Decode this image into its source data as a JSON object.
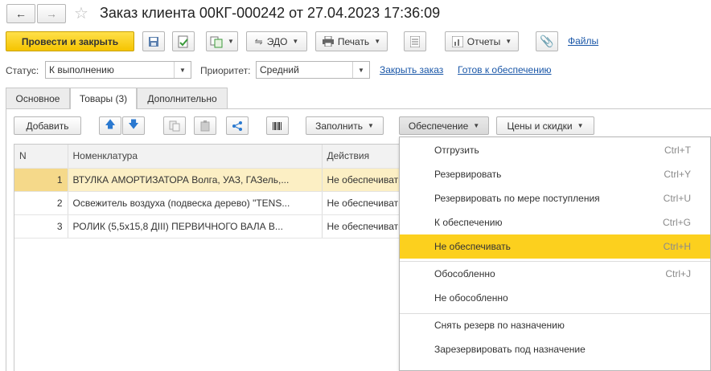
{
  "window": {
    "title": "Заказ клиента 00КГ-000242 от 27.04.2023 17:36:09"
  },
  "toolbar": {
    "post_close_label": "Провести и закрыть",
    "edo_label": "ЭДО",
    "print_label": "Печать",
    "reports_label": "Отчеты",
    "files_label": "Файлы"
  },
  "fields": {
    "status_label": "Статус:",
    "status_value": "К выполнению",
    "priority_label": "Приоритет:",
    "priority_value": "Средний",
    "close_order_link": "Закрыть заказ",
    "ready_link": "Готов к обеспечению"
  },
  "tabs": [
    {
      "label": "Основное"
    },
    {
      "label": "Товары (3)"
    },
    {
      "label": "Дополнительно"
    }
  ],
  "table_toolbar": {
    "add_label": "Добавить",
    "fill_label": "Заполнить",
    "provision_label": "Обеспечение",
    "prices_label": "Цены и скидки"
  },
  "table": {
    "headers": {
      "n": "N",
      "nomenclature": "Номенклатура",
      "actions": "Действия"
    },
    "rows": [
      {
        "n": "1",
        "nomenclature": "ВТУЛКА АМОРТИЗАТОРА Волга, УАЗ, ГАЗель,...",
        "action": "Не обеспечивать"
      },
      {
        "n": "2",
        "nomenclature": "Освежитель воздуха (подвеска дерево) \"TENS...",
        "action": "Не обеспечивать"
      },
      {
        "n": "3",
        "nomenclature": "РОЛИК (5,5х15,8  ДIII) ПЕРВИЧНОГО ВАЛА В...",
        "action": "Не обеспечивать"
      }
    ]
  },
  "menu": {
    "items": [
      {
        "label": "Отгрузить",
        "shortcut": "Ctrl+T"
      },
      {
        "label": "Резервировать",
        "shortcut": "Ctrl+Y"
      },
      {
        "label": "Резервировать по мере поступления",
        "shortcut": "Ctrl+U"
      },
      {
        "label": "К обеспечению",
        "shortcut": "Ctrl+G"
      },
      {
        "label": "Не обеспечивать",
        "shortcut": "Ctrl+H"
      },
      {
        "label": "Обособленно",
        "shortcut": "Ctrl+J"
      },
      {
        "label": "Не обособленно",
        "shortcut": ""
      },
      {
        "label": "Снять резерв по назначению",
        "shortcut": ""
      },
      {
        "label": "Зарезервировать под назначение",
        "shortcut": ""
      }
    ]
  },
  "colors": {
    "accent_yellow": "#fcd01e",
    "link_blue": "#1a57a8",
    "selected_row": "#fcefc4"
  }
}
